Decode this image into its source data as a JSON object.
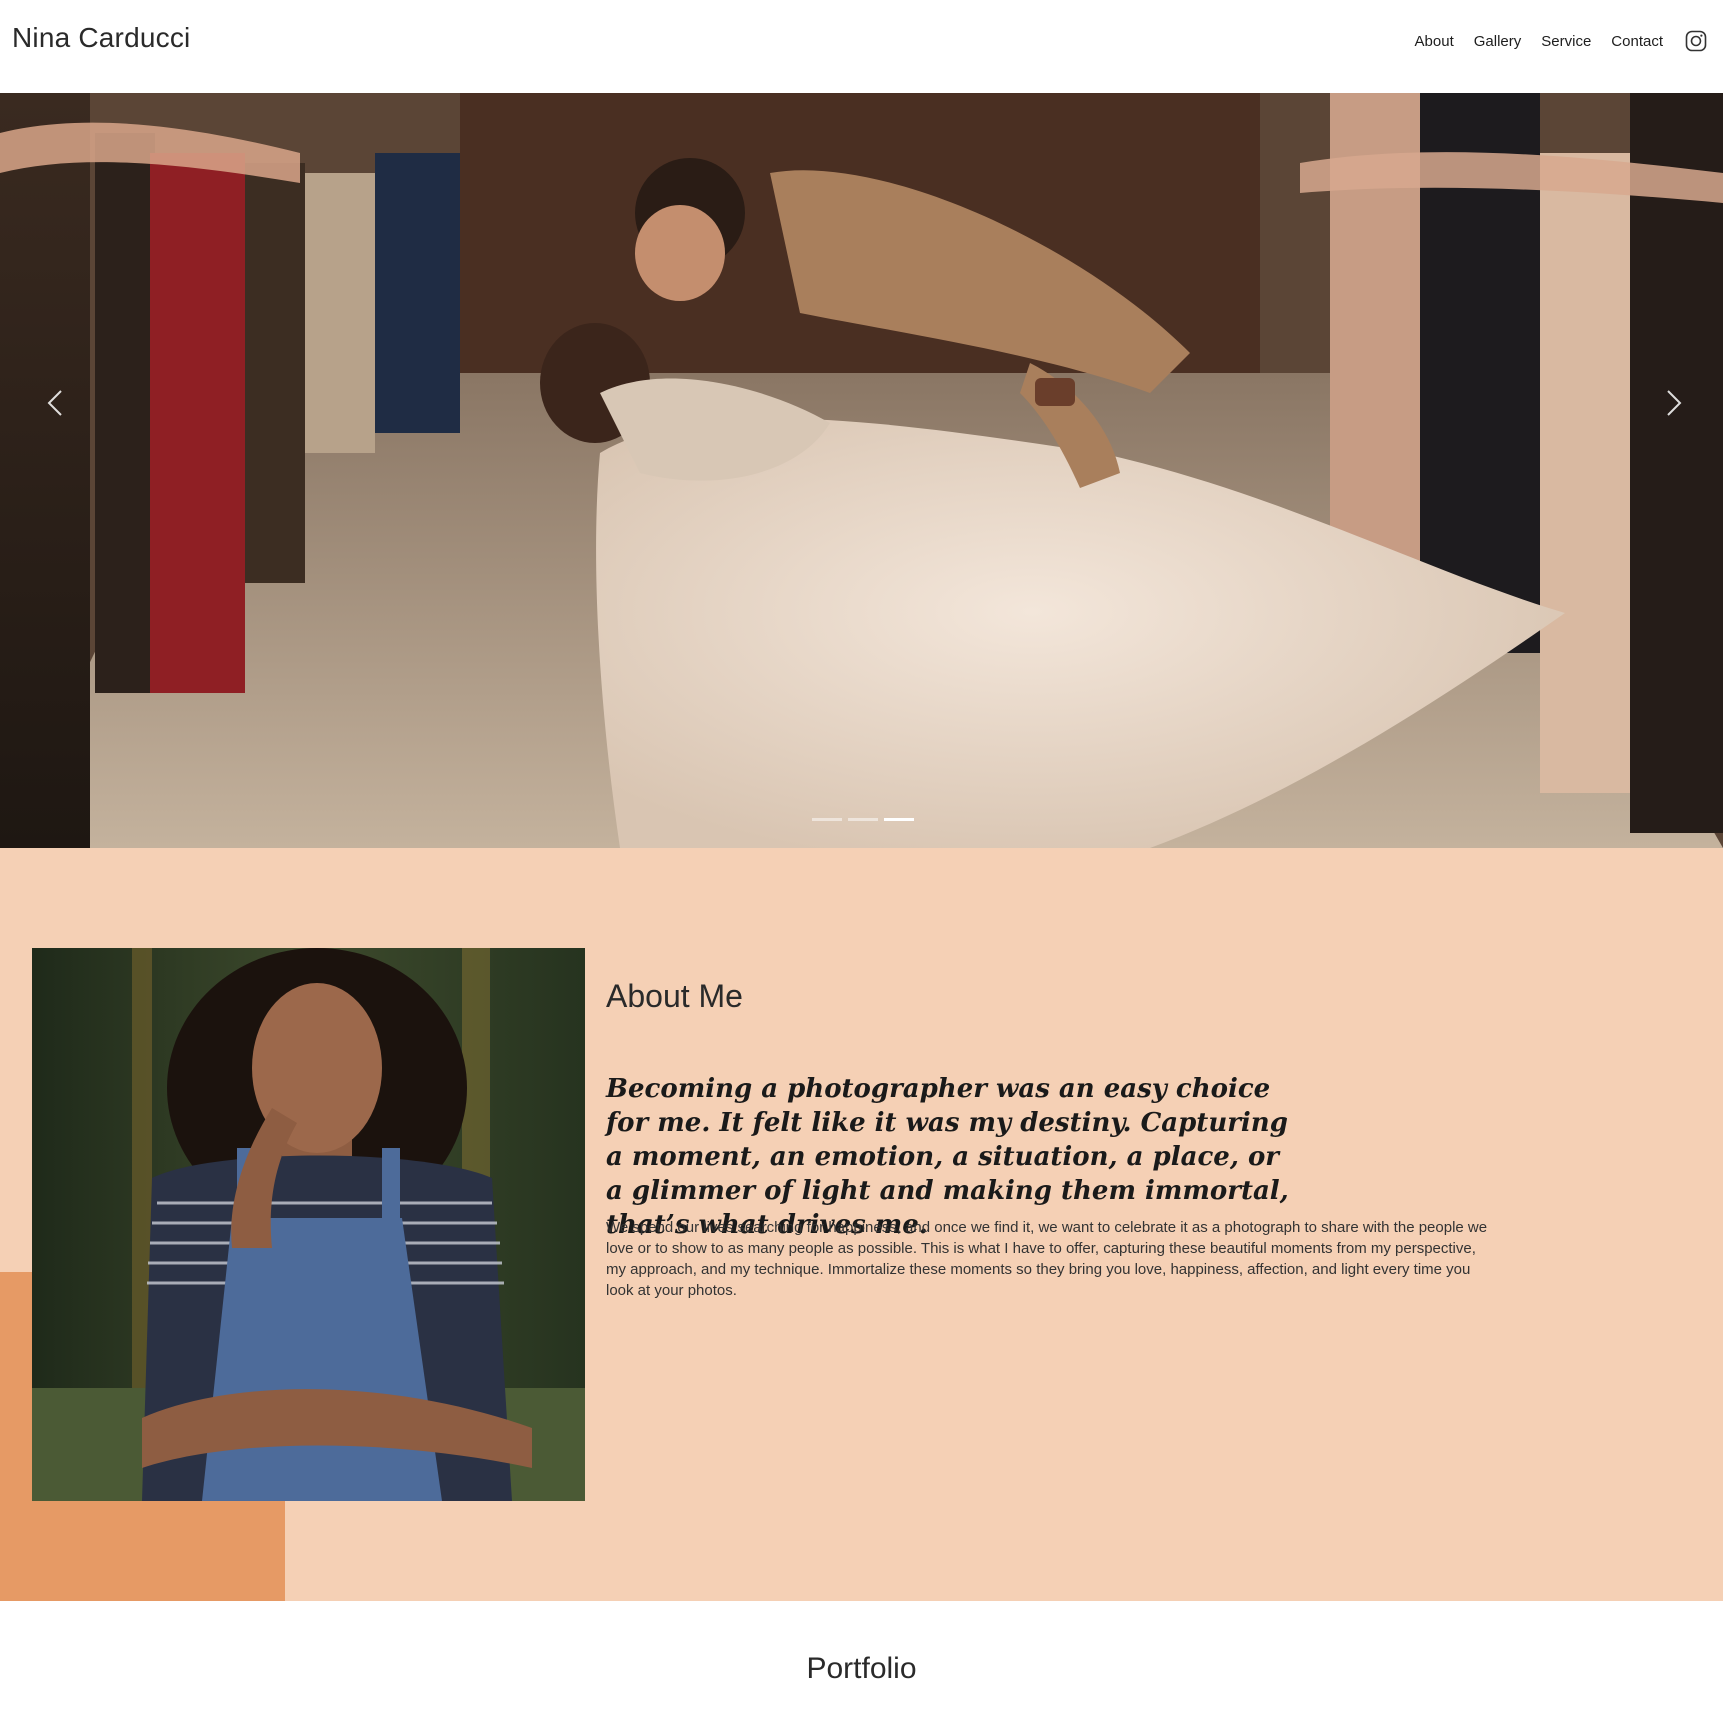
{
  "header": {
    "brand": "Nina Carducci",
    "nav": [
      {
        "label": "About"
      },
      {
        "label": "Gallery"
      },
      {
        "label": "Service"
      },
      {
        "label": "Contact"
      }
    ],
    "social_icon": "instagram-icon"
  },
  "hero": {
    "image_subject": "wedding couple kissing between guests",
    "slides_total": 3,
    "active_slide": 3,
    "prev_icon": "chevron-left-icon",
    "next_icon": "chevron-right-icon"
  },
  "about": {
    "title": "About Me",
    "quote": "Becoming a photographer was an easy choice for me. It felt like it was my destiny. Capturing a moment, an emotion, a situation, a place, or a glimmer of light and making them immortal, that’s what drives me.",
    "body": "We spend our lives searching for happiness, and once we find it, we want to celebrate it as a photograph to share with the people we love or to show to as many people as possible. This is what I have to offer, capturing these beautiful moments from my perspective, my approach, and my technique. Immortalize these moments so they bring you love, happiness, affection, and light every time you look at your photos.",
    "background": "#f5d0b5",
    "accent": "#e69a65"
  },
  "portfolio": {
    "title": "Portfolio"
  }
}
